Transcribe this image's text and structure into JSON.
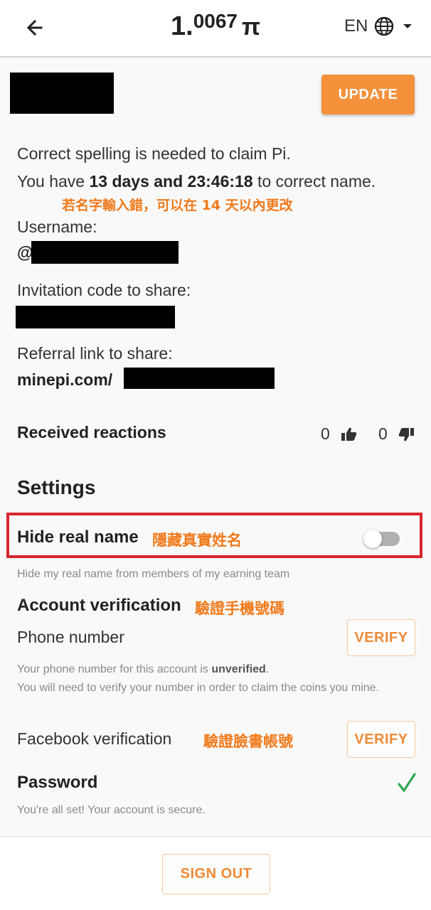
{
  "header": {
    "balance_int": "1.",
    "balance_dec": "0067",
    "currency_symbol": "π",
    "language": "EN"
  },
  "profile": {
    "update_label": "UPDATE",
    "spelling_notice": "Correct spelling is needed to claim Pi.",
    "correction_prefix": "You have ",
    "correction_time": "13 days and 23:46:18",
    "correction_suffix": " to correct name.",
    "annotation_name": "若名字輸入錯，可以在 14 天以內更改",
    "username_label": "Username:",
    "username_prefix": "@",
    "invite_label": "Invitation code to share:",
    "referral_label": "Referral link to share:",
    "referral_prefix": "minepi.com/"
  },
  "reactions": {
    "label": "Received reactions",
    "likes": "0",
    "dislikes": "0"
  },
  "settings": {
    "title": "Settings",
    "hide_name_label": "Hide real name",
    "hide_name_annotation": "隱藏真實姓名",
    "hide_name_enabled": false,
    "hide_name_desc": "Hide my real name from members of my earning team",
    "account_verification_label": "Account verification",
    "account_verification_annotation": "驗證手機號碼",
    "phone_label": "Phone number",
    "verify_label": "VERIFY",
    "phone_status_prefix": "Your phone number for this account is ",
    "phone_status_value": "unverified",
    "phone_status_suffix": ".",
    "phone_note": "You will need to verify your number in order to claim the coins you mine.",
    "facebook_label": "Facebook verification",
    "facebook_annotation": "驗證臉書帳號",
    "facebook_verify_label": "VERIFY",
    "password_label": "Password",
    "password_status": "You're all set! Your account is secure."
  },
  "footer": {
    "sign_out_label": "SIGN OUT"
  },
  "colors": {
    "accent": "#f4913a",
    "annotation": "#f07a1b",
    "highlight_border": "#d8262e",
    "check": "#2fa84f"
  },
  "icons": [
    "back-arrow-icon",
    "globe-icon",
    "dropdown-caret-icon",
    "thumbs-up-icon",
    "thumbs-down-icon",
    "checkmark-icon"
  ]
}
